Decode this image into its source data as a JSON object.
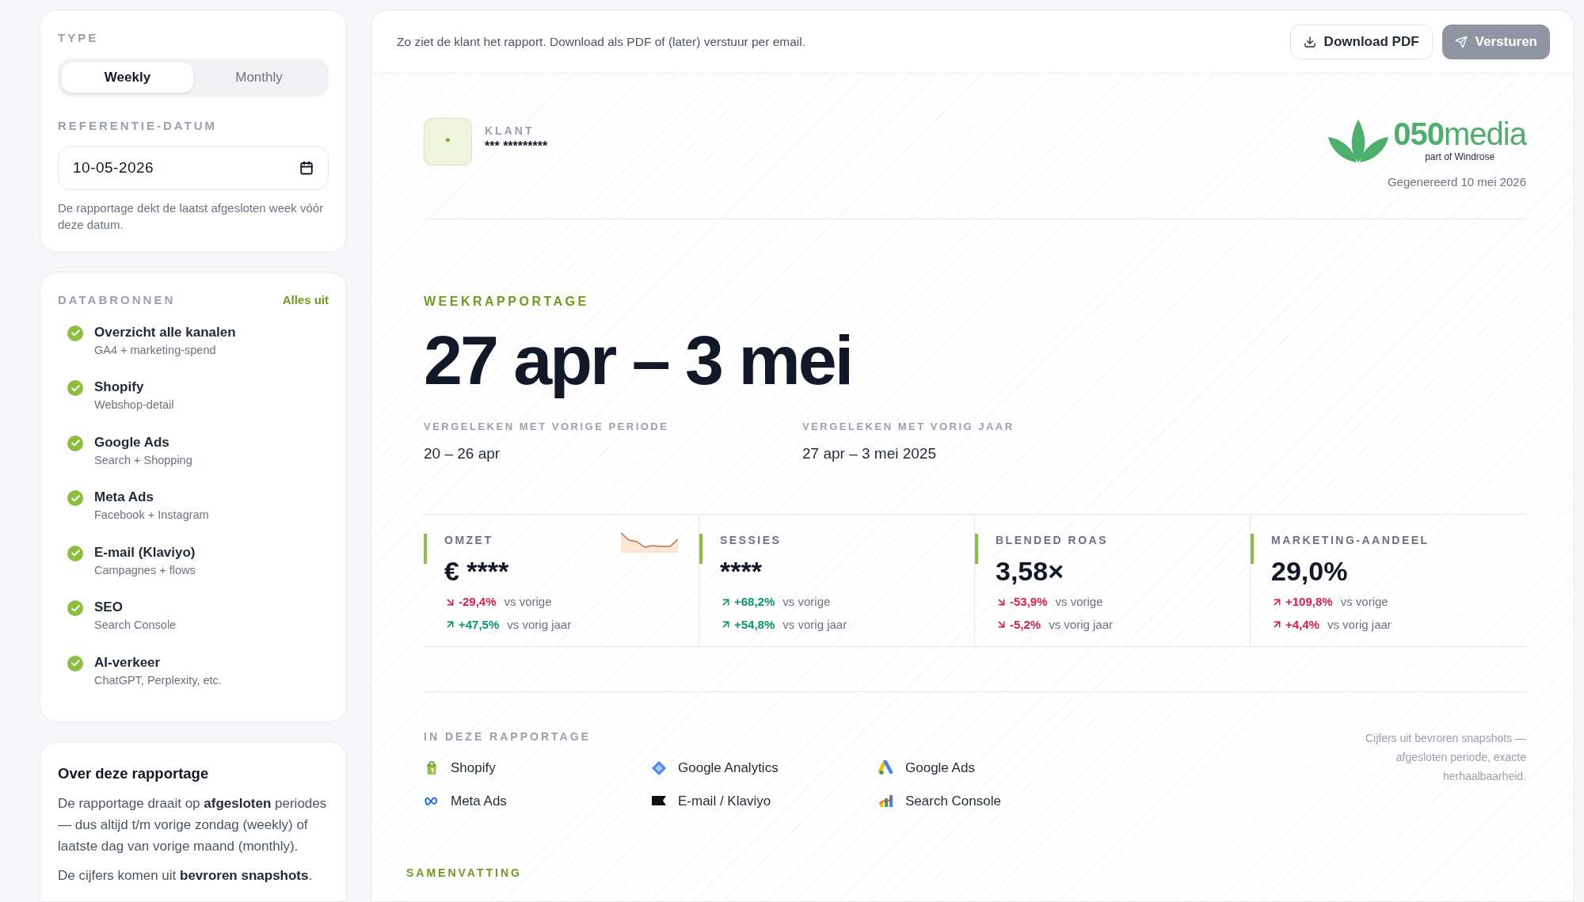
{
  "sidebar": {
    "type_section": {
      "label": "TYPE",
      "options": [
        {
          "label": "Weekly",
          "selected": true
        },
        {
          "label": "Monthly",
          "selected": false
        }
      ]
    },
    "date_section": {
      "label": "REFERENTIE-DATUM",
      "value": "10-05-2026",
      "hint": "De rapportage dekt de laatst afgesloten week vóór deze datum."
    },
    "sources": {
      "label": "DATABRONNEN",
      "action": "Alles uit",
      "items": [
        {
          "title": "Overzicht alle kanalen",
          "subtitle": "GA4 + marketing-spend",
          "checked": true
        },
        {
          "title": "Shopify",
          "subtitle": "Webshop-detail",
          "checked": true
        },
        {
          "title": "Google Ads",
          "subtitle": "Search + Shopping",
          "checked": true
        },
        {
          "title": "Meta Ads",
          "subtitle": "Facebook + Instagram",
          "checked": true
        },
        {
          "title": "E-mail (Klaviyo)",
          "subtitle": "Campagnes + flows",
          "checked": true
        },
        {
          "title": "SEO",
          "subtitle": "Search Console",
          "checked": true
        },
        {
          "title": "AI-verkeer",
          "subtitle": "ChatGPT, Perplexity, etc.",
          "checked": true
        }
      ]
    },
    "about": {
      "title": "Over deze rapportage",
      "paragraphs": [
        "De rapportage draait op **afgesloten** periodes — dus altijd t/m vorige zondag (weekly) of laatste dag van vorige maand (monthly).",
        "De cijfers komen uit **bevroren snapshots**."
      ]
    }
  },
  "toolbar": {
    "info": "Zo ziet de klant het rapport. Download als PDF of (later) verstuur per email.",
    "buttons": [
      {
        "label": "Download PDF",
        "kind": "download",
        "disabled": false
      },
      {
        "label": "Versturen",
        "kind": "send",
        "disabled": true
      }
    ]
  },
  "report": {
    "client": {
      "avatar": "*",
      "label": "KLANT",
      "name": "*** *********"
    },
    "brand": {
      "name": "**050**media",
      "tagline": "part of Windrose"
    },
    "generated": "Gegenereerd 10 mei 2026",
    "eyebrow": "WEEKRAPPORTAGE",
    "period": "27 apr – 3 mei",
    "comparisons": [
      {
        "label": "VERGELEKEN MET VORIGE PERIODE",
        "value": "20 – 26 apr"
      },
      {
        "label": "VERGELEKEN MET VORIG JAAR",
        "value": "27 apr – 3 mei 2025"
      }
    ],
    "kpis": [
      {
        "label": "OMZET",
        "value": "€ ****",
        "sparkline": true,
        "deltas": [
          {
            "value": "-29,4%",
            "kind": "down",
            "positive": false,
            "label": "vs vorige"
          },
          {
            "value": "+47,5%",
            "kind": "up",
            "positive": true,
            "label": "vs vorig jaar"
          }
        ]
      },
      {
        "label": "SESSIES",
        "value": "****",
        "deltas": [
          {
            "value": "+68,2%",
            "kind": "up",
            "positive": true,
            "label": "vs vorige"
          },
          {
            "value": "+54,8%",
            "kind": "up",
            "positive": true,
            "label": "vs vorig jaar"
          }
        ]
      },
      {
        "label": "BLENDED ROAS",
        "value": "3,58×",
        "deltas": [
          {
            "value": "-53,9%",
            "kind": "down",
            "positive": false,
            "label": "vs vorige"
          },
          {
            "value": "-5,2%",
            "kind": "down",
            "positive": false,
            "label": "vs vorig jaar"
          }
        ]
      },
      {
        "label": "MARKETING-AANDEEL",
        "value": "29,0%",
        "deltas": [
          {
            "value": "+109,8%",
            "kind": "up",
            "positive": false,
            "label": "vs vorige"
          },
          {
            "value": "+4,4%",
            "kind": "up",
            "positive": false,
            "label": "vs vorig jaar"
          }
        ]
      }
    ],
    "sources": {
      "label": "IN DEZE RAPPORTAGE",
      "items": [
        {
          "name": "Shopify",
          "kind": "shopify"
        },
        {
          "name": "Google Analytics",
          "kind": "analytics"
        },
        {
          "name": "Google Ads",
          "kind": "ads"
        },
        {
          "name": "Meta Ads",
          "kind": "meta"
        },
        {
          "name": "E-mail / Klaviyo",
          "kind": "klaviyo"
        },
        {
          "name": "Search Console",
          "kind": "console"
        }
      ],
      "note": "Cijfers uit bevroren snapshots — afgesloten periode, exacte herhaalbaarheid."
    },
    "next_section": "SAMENVATTING"
  }
}
